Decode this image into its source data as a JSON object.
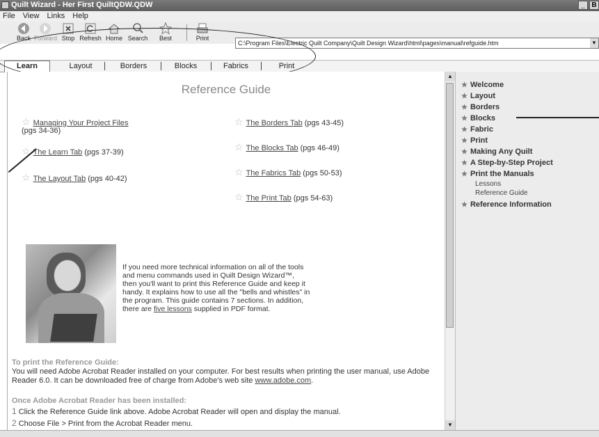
{
  "window": {
    "title": "Quilt Wizard - Her First QuiltQDW.QDW",
    "buttons": [
      "_",
      "B"
    ]
  },
  "menu": [
    "File",
    "View",
    "Links",
    "Help"
  ],
  "toolbar": {
    "buttons": [
      {
        "label": "Back",
        "icon": "back-icon"
      },
      {
        "label": "Forward",
        "icon": "forward-icon"
      },
      {
        "label": "Stop",
        "icon": "stop-icon"
      },
      {
        "label": "Refresh",
        "icon": "refresh-icon"
      },
      {
        "label": "Home",
        "icon": "home-icon"
      },
      {
        "label": "Search",
        "icon": "search-icon"
      },
      {
        "label": "Best",
        "icon": "star-icon"
      },
      {
        "label": "Print",
        "icon": "print-icon"
      }
    ],
    "address": "C:\\Program Files\\Electric Quilt Company\\Quilt Design Wizard\\html\\pages\\manual\\refguide.htm"
  },
  "tabs": [
    "Learn",
    "Layout",
    "Borders",
    "Blocks",
    "Fabrics",
    "Print"
  ],
  "main": {
    "title": "Reference Guide",
    "links_left": [
      {
        "text": "Managing Your Project Files",
        "pages": "(pgs 34-36)"
      },
      {
        "text": "The Learn Tab",
        "pages": "(pgs 37-39)"
      },
      {
        "text": "The Layout Tab",
        "pages": "(pgs 40-42)"
      }
    ],
    "links_right": [
      {
        "text": "The Borders Tab",
        "pages": "(pgs 43-45)"
      },
      {
        "text": "The Blocks Tab",
        "pages": "(pgs 46-49)"
      },
      {
        "text": "The Fabrics Tab",
        "pages": "(pgs 50-53)"
      },
      {
        "text": "The Print Tab",
        "pages": "(pgs 54-63)"
      }
    ],
    "info_text": "If you need more technical information on all of the tools and menu commands used in Quilt Design Wizard™, then you'll want to print this Reference Guide and keep it handy. It explains how to use all the \"bells and whistles\" in the program. This guide contains 7 sections. In addition, there are",
    "info_link": "five lessons",
    "info_tail": "supplied in PDF format.",
    "print_heading": "To print the Reference Guide:",
    "print_text": "You will need Adobe Acrobat Reader installed on your computer. For best results when printing the user manual, use Adobe Reader 6.0. It can be downloaded free of charge from Adobe's web site",
    "adobe_link": "www.adobe.com",
    "once_heading": "Once Adobe Acrobat Reader has been installed:",
    "steps": [
      {
        "num": "1",
        "text": "Click the Reference Guide link above. Adobe Acrobat Reader will open and display the manual."
      },
      {
        "num": "2",
        "text": "Choose File > Print from the Acrobat Reader menu."
      }
    ]
  },
  "sidebar": {
    "items": [
      "Welcome",
      "Layout",
      "Borders",
      "Blocks",
      "Fabric",
      "Print",
      "Making Any Quilt",
      "A Step-by-Step Project",
      "Print the Manuals",
      "Reference Information"
    ],
    "subitems": [
      "Lessons",
      "Reference Guide"
    ]
  }
}
